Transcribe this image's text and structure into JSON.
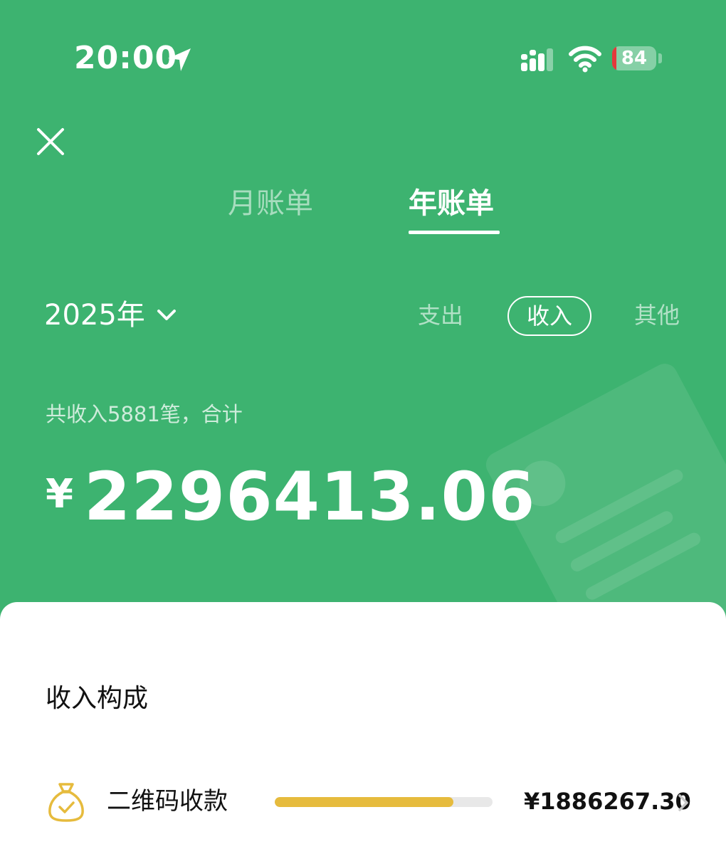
{
  "status_bar": {
    "time": "20:00",
    "battery": "84",
    "battery_level": 0.1
  },
  "tabs": [
    {
      "label": "月账单",
      "active": false
    },
    {
      "label": "年账单",
      "active": true
    }
  ],
  "period": {
    "year": "2025年"
  },
  "filters": {
    "expense": "支出",
    "income": "收入",
    "other": "其他",
    "selected": "收入"
  },
  "summary": {
    "caption": "共收入5881笔，合计",
    "currency": "¥",
    "total": "2296413.06"
  },
  "composition": {
    "title": "收入构成",
    "items": [
      {
        "label": "二维码收款",
        "value": "¥1886267.30",
        "share": 0.82,
        "icon": "money-bag-icon"
      }
    ]
  },
  "colors": {
    "brand_green": "#3db370",
    "bar_gold": "#e6bb3d",
    "battery_red": "#e5383b"
  },
  "icons": [
    "location-arrow-icon",
    "cellular-signal-icon",
    "wifi-icon",
    "battery-icon",
    "close-icon",
    "chevron-down-icon",
    "money-bag-icon",
    "chevron-right-icon"
  ]
}
